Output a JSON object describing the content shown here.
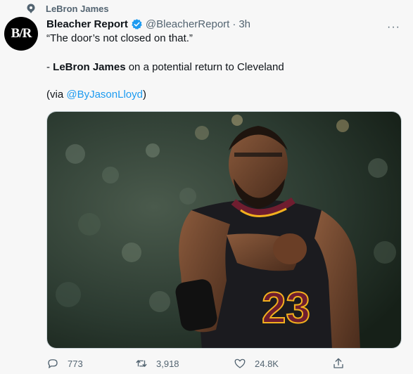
{
  "topic": {
    "label": "LeBron James"
  },
  "tweet": {
    "author_name": "Bleacher Report",
    "handle": "@BleacherReport",
    "separator": "·",
    "time": "3h",
    "avatar_text": "B/R",
    "more": "···",
    "line1": "“The door’s not closed on that.”",
    "line2_prefix": "- ",
    "line2_bold": "LeBron James",
    "line2_suffix": " on a potential return to Cleveland",
    "line3_prefix": "(via ",
    "line3_link": "@ByJasonLloyd",
    "line3_suffix": ")",
    "jersey_number": "23"
  },
  "actions": {
    "replies": "773",
    "retweets": "3,918",
    "likes": "24.8K"
  },
  "colors": {
    "link": "#1d9bf0",
    "secondary_text": "#536471",
    "jersey": "#6f1d2f",
    "jersey_gold": "#f2b01e"
  }
}
